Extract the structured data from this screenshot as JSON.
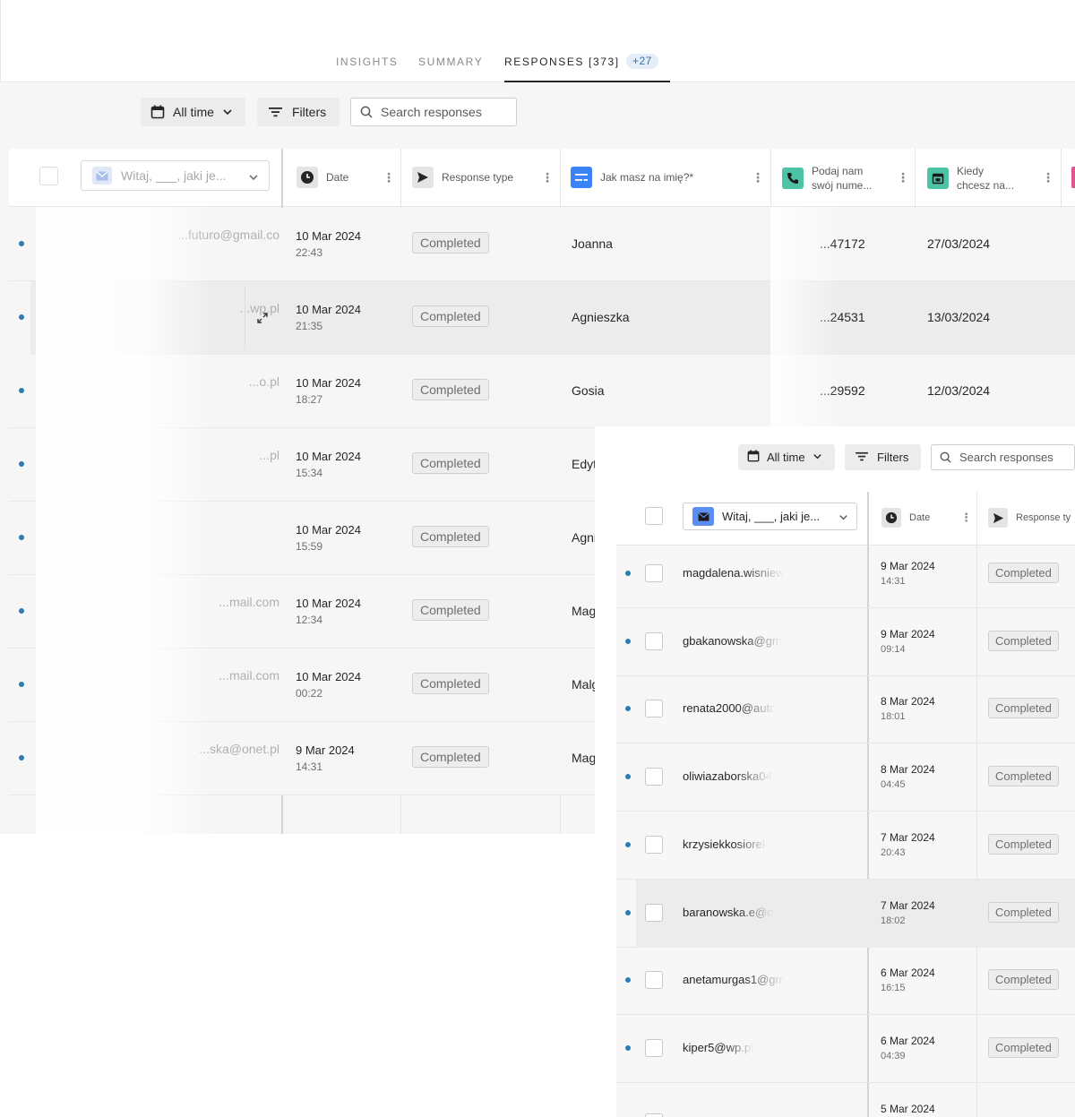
{
  "tabs": [
    {
      "label": "INSIGHTS"
    },
    {
      "label": "SUMMARY"
    },
    {
      "label": "RESPONSES [373]"
    }
  ],
  "new_count": "+27",
  "toolbar": {
    "time_filter": "All time",
    "filters_label": "Filters",
    "search_placeholder": "Search responses"
  },
  "columns": {
    "question_selector": "Witaj, ___, jaki je...",
    "date": "Date",
    "response_type": "Response type",
    "name": "Jak masz na imię?*",
    "phone": "Podaj nam swój nume...",
    "when": "Kiedy chcesz na..."
  },
  "rows": [
    {
      "email": "...futuro@gmail.co",
      "date": "10 Mar 2024",
      "time": "22:43",
      "type": "Completed",
      "name": "Joanna",
      "phone": "...47172",
      "when": "27/03/2024"
    },
    {
      "email": "...wp.pl",
      "date": "10 Mar 2024",
      "time": "21:35",
      "type": "Completed",
      "name": "Agnieszka",
      "phone": "...24531",
      "when": "13/03/2024"
    },
    {
      "email": "...o.pl",
      "date": "10 Mar 2024",
      "time": "18:27",
      "type": "Completed",
      "name": "Gosia",
      "phone": "...29592",
      "when": "12/03/2024"
    },
    {
      "email": "...pl",
      "date": "10 Mar 2024",
      "time": "15:34",
      "type": "Completed",
      "name": "Edyt",
      "phone": "",
      "when": ""
    },
    {
      "email": "",
      "date": "10 Mar 2024",
      "time": "15:59",
      "type": "Completed",
      "name": "Agni",
      "phone": "",
      "when": ""
    },
    {
      "email": "...mail.com",
      "date": "10 Mar 2024",
      "time": "12:34",
      "type": "Completed",
      "name": "Mag",
      "phone": "",
      "when": ""
    },
    {
      "email": "...mail.com",
      "date": "10 Mar 2024",
      "time": "00:22",
      "type": "Completed",
      "name": "Malg",
      "phone": "",
      "when": ""
    },
    {
      "email": "...ska@onet.pl",
      "date": "9 Mar 2024",
      "time": "14:31",
      "type": "Completed",
      "name": "Mag",
      "phone": "",
      "when": ""
    }
  ],
  "overlay": {
    "time_filter": "All time",
    "filters_label": "Filters",
    "search_placeholder": "Search responses",
    "question_selector": "Witaj, ___, jaki je...",
    "date_header": "Date",
    "type_header": "Response ty",
    "rows": [
      {
        "email": "magdalena.wisniew",
        "date": "9 Mar 2024",
        "time": "14:31",
        "type": "Completed"
      },
      {
        "email": "gbakanowska@gm",
        "date": "9 Mar 2024",
        "time": "09:14",
        "type": "Completed"
      },
      {
        "email": "renata2000@auto",
        "date": "8 Mar 2024",
        "time": "18:01",
        "type": "Completed"
      },
      {
        "email": "oliwiazaborska04",
        "date": "8 Mar 2024",
        "time": "04:45",
        "type": "Completed"
      },
      {
        "email": "krzysiekkosiorek",
        "date": "7 Mar 2024",
        "time": "20:43",
        "type": "Completed"
      },
      {
        "email": "baranowska.e@o",
        "date": "7 Mar 2024",
        "time": "18:02",
        "type": "Completed"
      },
      {
        "email": "anetamurgas1@gm",
        "date": "6 Mar 2024",
        "time": "16:15",
        "type": "Completed"
      },
      {
        "email": "kiper5@wp.pl",
        "date": "6 Mar 2024",
        "time": "04:39",
        "type": "Completed"
      },
      {
        "email": "",
        "date": "5 Mar 2024",
        "time": "",
        "type": ""
      }
    ]
  },
  "colors": {
    "accent_blue": "#2f7cb3",
    "phone_icon": "#4cc3a4",
    "calendar_icon": "#4cc3a4",
    "short_text_icon": "#3b82f6",
    "email_icon": "#5b8ef0"
  }
}
